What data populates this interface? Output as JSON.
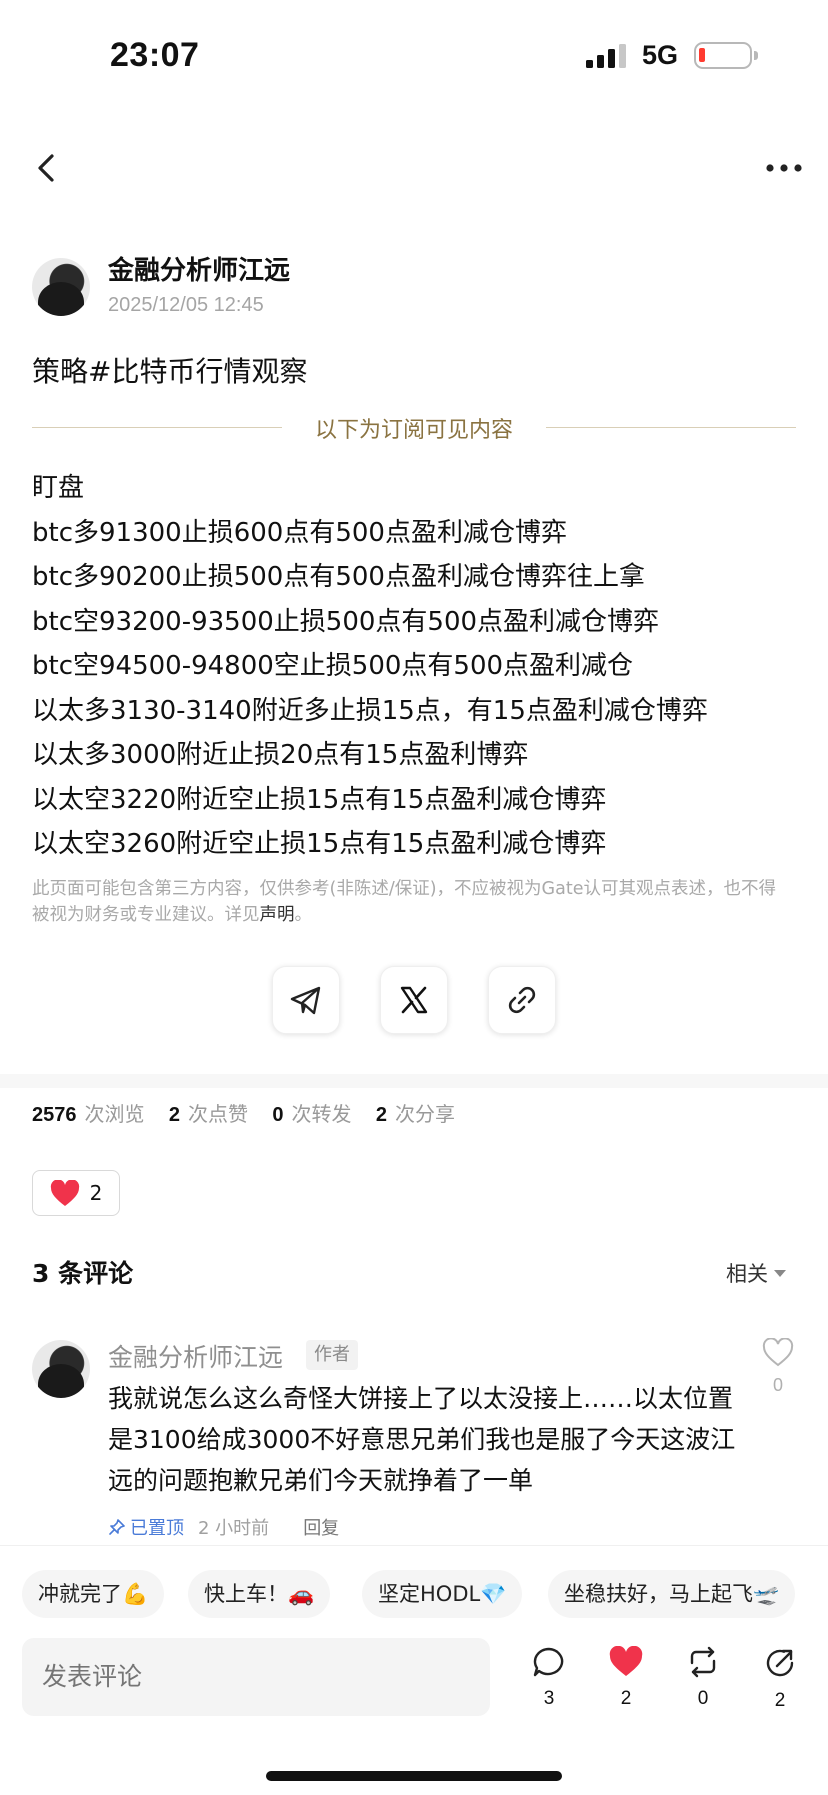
{
  "status_bar": {
    "time": "23:07",
    "network": "5G"
  },
  "post": {
    "author": "金融分析师江远",
    "timestamp": "2025/12/05 12:45",
    "title": "策略#比特币行情观察",
    "subscriber_divider": "以下为订阅可见内容",
    "lines": [
      "盯盘",
      "btc多91300止损600点有500点盈利减仓博弈",
      "btc多90200止损500点有500点盈利减仓博弈往上拿",
      "btc空93200-93500止损500点有500点盈利减仓博弈",
      "btc空94500-94800空止损500点有500点盈利减仓",
      "以太多3130-3140附近多止损15点，有15点盈利减仓博弈",
      "以太多3000附近止损20点有15点盈利博弈",
      "以太空3220附近空止损15点有15点盈利减仓博弈",
      "以太空3260附近空止损15点有15点盈利减仓博弈"
    ],
    "disclaimer": "此页面可能包含第三方内容，仅供参考(非陈述/保证)，不应被视为Gate认可其观点表述，也不得被视为财务或专业建议。详见",
    "disclaimer_link": "声明",
    "disclaimer_end": "。"
  },
  "stats": {
    "views": "2576",
    "views_label": "次浏览",
    "likes": "2",
    "likes_label": "次点赞",
    "reposts": "0",
    "reposts_label": "次转发",
    "shares": "2",
    "shares_label": "次分享"
  },
  "reaction": {
    "count": "2"
  },
  "comments": {
    "title": "3 条评论",
    "sort": "相关",
    "items": [
      {
        "author": "金融分析师江远",
        "badge": "作者",
        "body": "我就说怎么这么奇怪大饼接上了以太没接上……以太位置是3100给成3000不好意思兄弟们我也是服了今天这波江远的问题抱歉兄弟们今天就挣着了一单",
        "pinned": "已置顶",
        "ago": "2 小时前",
        "reply": "回复",
        "likes": "0"
      }
    ]
  },
  "quick_replies": [
    "冲就完了💪",
    "快上车！🚗",
    "坚定HODL💎",
    "坐稳扶好，马上起飞🛫"
  ],
  "composer": {
    "placeholder": "发表评论",
    "comments": "3",
    "likes": "2",
    "reposts": "0",
    "shares": "2"
  },
  "colors": {
    "accent_gold": "#8a7341",
    "heart_red": "#f0334b",
    "pinned_blue": "#4a7bd8"
  }
}
